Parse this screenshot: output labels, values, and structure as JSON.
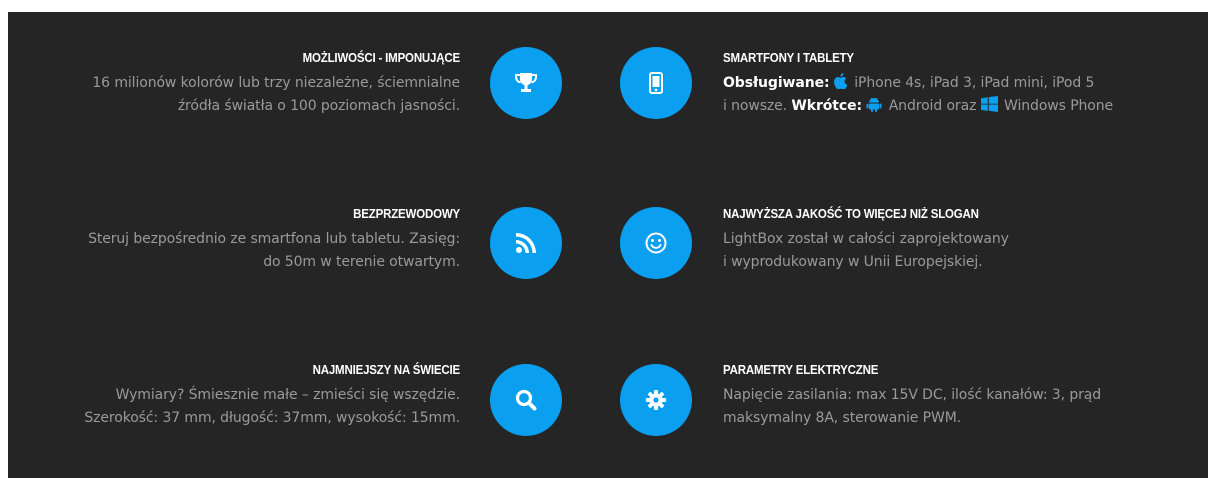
{
  "colors": {
    "background": "#252525",
    "accent": "#0b9ff0",
    "title": "#ffffff",
    "text": "#9a9a9a"
  },
  "features": {
    "possibilities": {
      "title": "MOŻLIWOŚCI - IMPONUJĄCE",
      "line1": "16 milionów kolorów lub trzy niezależne, ściemnialne",
      "line2": "źródła światła o 100 poziomach jasności.",
      "icon": "trophy-icon"
    },
    "devices": {
      "title": "SMARTFONY I TABLETY",
      "supported_label": "Obsługiwane:",
      "supported_text": "iPhone 4s, iPad 3, iPad mini, iPod 5",
      "line2_start": "i nowsze.",
      "soon_label": "Wkrótce:",
      "android_text": "Android oraz",
      "windows_text": "Windows Phone",
      "icon": "smartphone-icon"
    },
    "wireless": {
      "title": "BEZPRZEWODOWY",
      "line1": "Steruj bezpośrednio ze smartfona lub tabletu. Zasięg:",
      "line2": "do 50m w terenie otwartym.",
      "icon": "rss-icon"
    },
    "quality": {
      "title": "NAJWYŻSZA JAKOŚĆ TO WIĘCEJ NIŻ SLOGAN",
      "line1": "LightBox został w całości zaprojektowany",
      "line2": "i wyprodukowany w Unii Europejskiej.",
      "icon": "smiley-icon"
    },
    "smallest": {
      "title": "NAJMNIEJSZY NA ŚWIECIE",
      "line1": "Wymiary? Śmiesznie małe – zmieści się wszędzie.",
      "line2": "Szerokość: 37 mm, długość: 37mm, wysokość: 15mm.",
      "icon": "search-icon"
    },
    "electrical": {
      "title": "PARAMETRY ELEKTRYCZNE",
      "line1": "Napięcie zasilania: max 15V DC, ilość kanałów: 3, prąd",
      "line2": "maksymalny 8A, sterowanie PWM.",
      "icon": "gear-icon"
    }
  }
}
